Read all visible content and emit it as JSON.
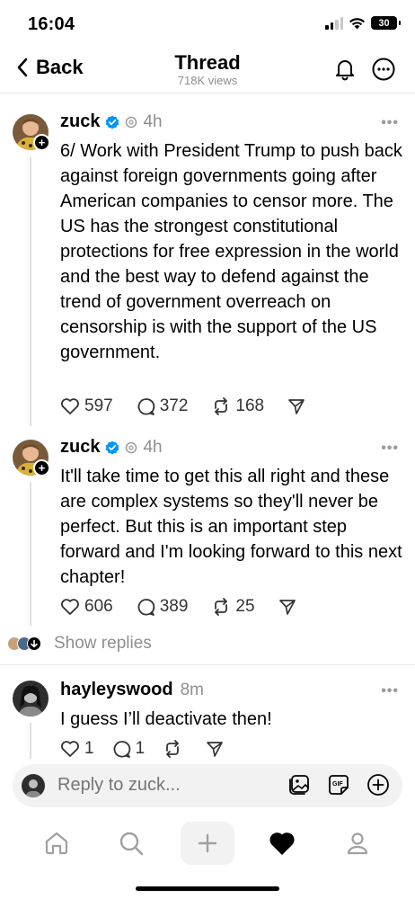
{
  "status": {
    "time": "16:04",
    "battery": "30"
  },
  "header": {
    "back_label": "Back",
    "title": "Thread",
    "views": "718K views"
  },
  "posts": [
    {
      "username": "zuck",
      "time": "4h",
      "text": "6/ Work with President Trump to push back against foreign governments going after American companies to censor more. The US has the strongest constitutional protections for free expression in the world and the best way to defend against the trend of government overreach on censorship is with the support of the US government.",
      "likes": "597",
      "replies": "372",
      "reposts": "168"
    },
    {
      "username": "zuck",
      "time": "4h",
      "text": "It'll take time to get this all right and these are complex systems so they'll never be perfect. But this is an important step forward and I'm looking forward to this next chapter!",
      "likes": "606",
      "replies": "389",
      "reposts": "25"
    }
  ],
  "show_replies": "Show replies",
  "reply": {
    "username": "hayleyswood",
    "time": "8m",
    "text": "I guess I’ll deactivate then!",
    "likes": "1",
    "replies": "1"
  },
  "replybar": {
    "placeholder": "Reply to zuck..."
  },
  "colors": {
    "verified": "#0095f6",
    "muted": "#8e8e8e",
    "divider": "#e8e8e8"
  }
}
